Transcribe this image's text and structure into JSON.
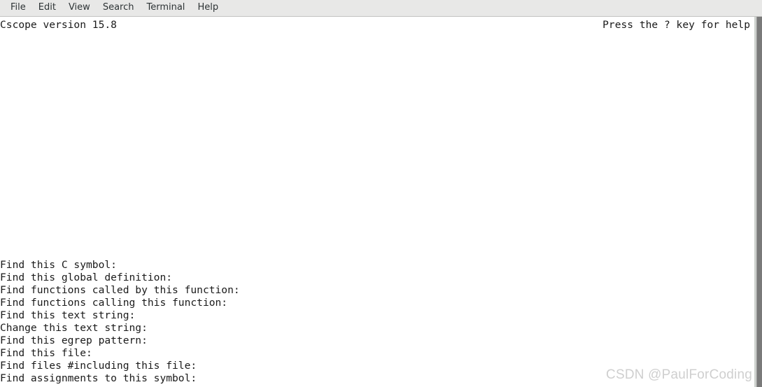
{
  "window": {
    "menubar": {
      "items": [
        {
          "label": "File",
          "name": "menu-item-file"
        },
        {
          "label": "Edit",
          "name": "menu-item-edit"
        },
        {
          "label": "View",
          "name": "menu-item-view"
        },
        {
          "label": "Search",
          "name": "menu-item-search"
        },
        {
          "label": "Terminal",
          "name": "menu-item-terminal"
        },
        {
          "label": "Help",
          "name": "menu-item-help"
        }
      ]
    }
  },
  "terminal": {
    "status": {
      "left": "Cscope version 15.8",
      "right": "Press the ? key for help"
    },
    "prompts": [
      "Find this C symbol:",
      "Find this global definition:",
      "Find functions called by this function:",
      "Find functions calling this function:",
      "Find this text string:",
      "Change this text string:",
      "Find this egrep pattern:",
      "Find this file:",
      "Find files #including this file:",
      "Find assignments to this symbol:"
    ]
  },
  "scrollbar": {
    "thumb_color": "#7a7a7a",
    "trough_color": "#cdd1cd"
  },
  "watermark": {
    "text": "CSDN @PaulForCoding",
    "color": "#cfcfcf"
  }
}
